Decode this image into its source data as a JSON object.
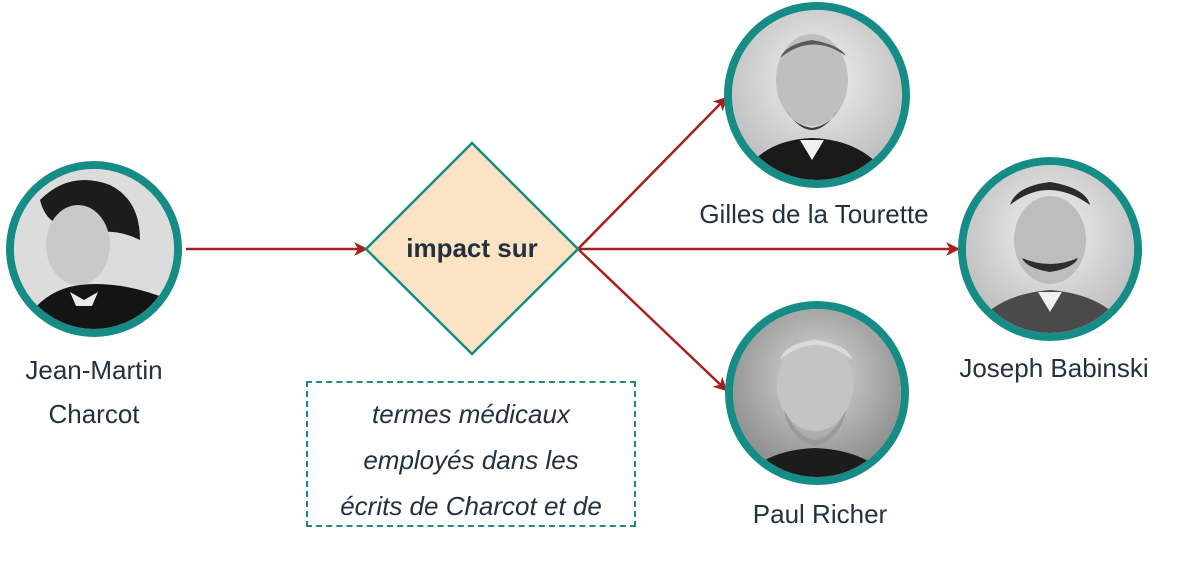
{
  "colors": {
    "ring": "#168c86",
    "arrow": "#a3221e",
    "diamond_fill": "#fbe3c3",
    "diamond_stroke": "#168c86",
    "note_border": "#1f8a85",
    "text": "#22313f"
  },
  "nodes": {
    "charcot": {
      "label_line1": "Jean-Martin",
      "label_line2": "Charcot"
    },
    "tourette": {
      "label": "Gilles de la Tourette"
    },
    "babinski": {
      "label": "Joseph Babinski"
    },
    "richer": {
      "label": "Paul Richer"
    }
  },
  "decision": {
    "label": "impact sur"
  },
  "note": {
    "lines": [
      "termes médicaux",
      "employés dans les",
      "écrits de Charcot et de"
    ]
  }
}
